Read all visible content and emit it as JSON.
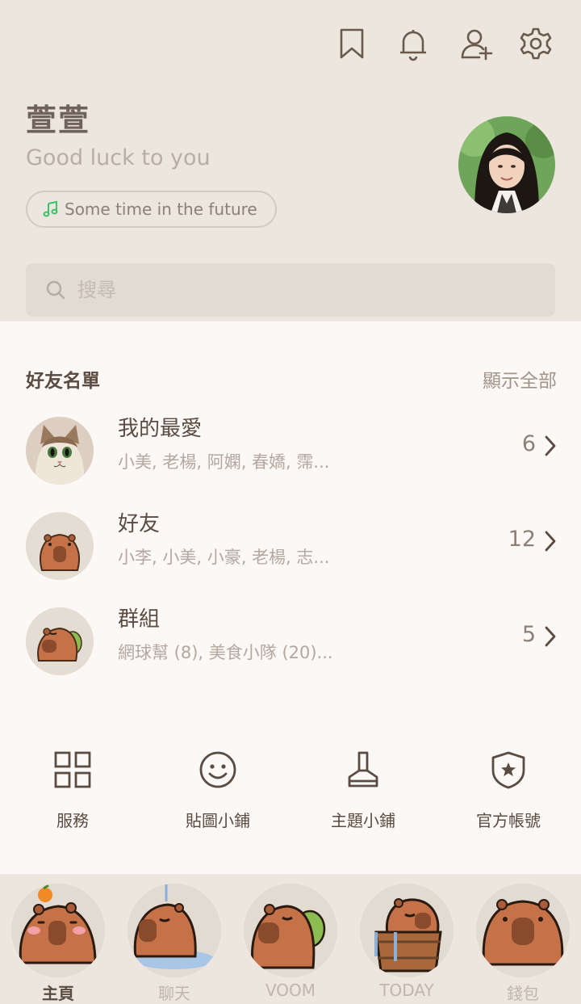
{
  "profile": {
    "name": "萱萱",
    "status_message": "Good luck to you",
    "music_label": "Some time in the future"
  },
  "search": {
    "placeholder": "搜尋"
  },
  "friends_section": {
    "title": "好友名單",
    "show_all_label": "顯示全部",
    "rows": [
      {
        "title": "我的最愛",
        "subtitle": "小美, 老楊, 阿嫻, 春嬌, 霈...",
        "count": "6"
      },
      {
        "title": "好友",
        "subtitle": "小李, 小美, 小豪, 老楊, 志...",
        "count": "12"
      },
      {
        "title": "群組",
        "subtitle": "網球幫 (8), 美食小隊 (20)...",
        "count": "5"
      }
    ]
  },
  "shortcuts": [
    {
      "label": "服務",
      "icon": "grid-icon"
    },
    {
      "label": "貼圖小鋪",
      "icon": "smiley-icon"
    },
    {
      "label": "主題小鋪",
      "icon": "brush-icon"
    },
    {
      "label": "官方帳號",
      "icon": "shield-star-icon"
    }
  ],
  "tabs": [
    {
      "label": "主頁",
      "active": true
    },
    {
      "label": "聊天",
      "active": false
    },
    {
      "label": "VOOM",
      "active": false
    },
    {
      "label": "TODAY",
      "active": false
    },
    {
      "label": "錢包",
      "active": false
    }
  ],
  "colors": {
    "accent_brown": "#c57248",
    "text_dark": "#5a4c42",
    "header_bg": "#ece6de",
    "content_bg": "#fcf8f5"
  }
}
